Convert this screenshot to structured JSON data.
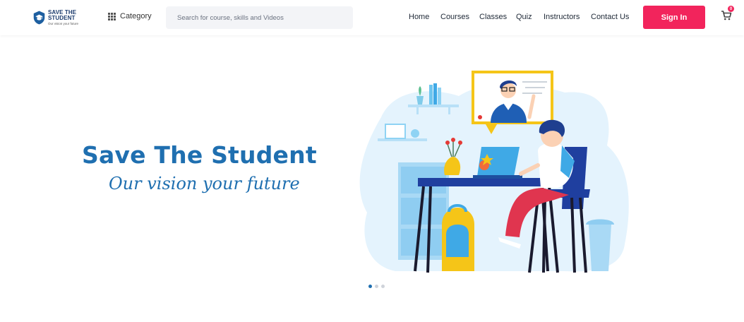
{
  "brand": {
    "name": "SAVE THE STUDENT",
    "tagline": "Our vision your future"
  },
  "header": {
    "category_label": "Category",
    "search_placeholder": "Search for course, skills and Videos",
    "nav": [
      "Home",
      "Courses",
      "Classes",
      "Quiz",
      "Instructors",
      "Contact Us"
    ],
    "signin_label": "Sign In",
    "cart_count": "0"
  },
  "hero": {
    "title": "Save The Student",
    "subtitle": "Our vision your future",
    "slides": 3,
    "active_slide": 1
  },
  "colors": {
    "accent": "#f2245c",
    "brand_blue": "#1f6fb0",
    "illustration_bg": "#e4f3fd"
  },
  "icons": [
    "graduation-logo-icon",
    "grid-icon",
    "cart-icon"
  ]
}
